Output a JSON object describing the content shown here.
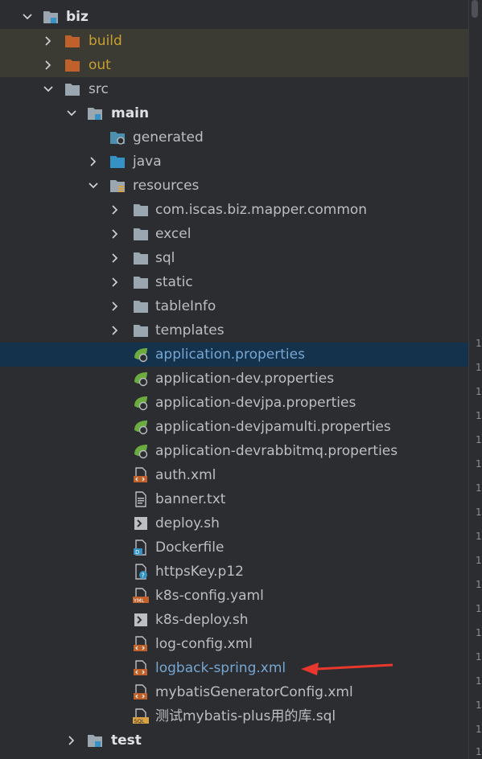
{
  "tree": {
    "nodes": [
      {
        "label": "biz",
        "style": "bold",
        "icon": "module-folder",
        "chevron": "down"
      },
      {
        "label": "build",
        "style": "orange",
        "icon": "folder-orange",
        "chevron": "right"
      },
      {
        "label": "out",
        "style": "orange",
        "icon": "folder-orange",
        "chevron": "right"
      },
      {
        "label": "src",
        "icon": "folder",
        "chevron": "down"
      },
      {
        "label": "main",
        "style": "bold",
        "icon": "module-folder",
        "chevron": "down"
      },
      {
        "label": "generated",
        "icon": "generated-folder"
      },
      {
        "label": "java",
        "icon": "java-folder",
        "chevron": "right"
      },
      {
        "label": "resources",
        "icon": "resources-folder",
        "chevron": "down"
      },
      {
        "label": "com.iscas.biz.mapper.common",
        "icon": "folder",
        "chevron": "right"
      },
      {
        "label": "excel",
        "icon": "folder",
        "chevron": "right"
      },
      {
        "label": "sql",
        "icon": "folder",
        "chevron": "right"
      },
      {
        "label": "static",
        "icon": "folder",
        "chevron": "right"
      },
      {
        "label": "tableInfo",
        "icon": "folder",
        "chevron": "right"
      },
      {
        "label": "templates",
        "icon": "folder",
        "chevron": "right"
      },
      {
        "label": "application.properties",
        "icon": "spring-properties-icon",
        "style": "blue",
        "selected": true
      },
      {
        "label": "application-dev.properties",
        "icon": "spring-properties-icon"
      },
      {
        "label": "application-devjpa.properties",
        "icon": "spring-properties-icon"
      },
      {
        "label": "application-devjpamulti.properties",
        "icon": "spring-properties-icon"
      },
      {
        "label": "application-devrabbitmq.properties",
        "icon": "spring-properties-icon"
      },
      {
        "label": "auth.xml",
        "icon": "xml-file-icon"
      },
      {
        "label": "banner.txt",
        "icon": "text-file-icon"
      },
      {
        "label": "deploy.sh",
        "icon": "shell-file-icon"
      },
      {
        "label": "Dockerfile",
        "icon": "docker-file-icon"
      },
      {
        "label": "httpsKey.p12",
        "icon": "unknown-file-icon"
      },
      {
        "label": "k8s-config.yaml",
        "icon": "yaml-file-icon"
      },
      {
        "label": "k8s-deploy.sh",
        "icon": "shell-file-icon"
      },
      {
        "label": "log-config.xml",
        "icon": "xml-file-icon"
      },
      {
        "label": "logback-spring.xml",
        "icon": "xml-file-icon",
        "style": "blue"
      },
      {
        "label": "mybatisGeneratorConfig.xml",
        "icon": "xml-file-icon"
      },
      {
        "label": "测试mybatis-plus用的库.sql",
        "icon": "sql-file-icon"
      },
      {
        "label": "test",
        "style": "bold",
        "icon": "module-folder",
        "chevron": "right"
      }
    ]
  },
  "gutter": {
    "marks": [
      "1",
      "1",
      "1",
      "1",
      "1",
      "1",
      "1",
      "1",
      "1",
      "1",
      "1",
      "1",
      "1",
      "1",
      "1",
      "1",
      "1",
      "1"
    ]
  },
  "colors": {
    "background": "#2b2d30",
    "selection": "#14324b",
    "excluded": "#3b3a33",
    "arrow": "#e8382d"
  }
}
